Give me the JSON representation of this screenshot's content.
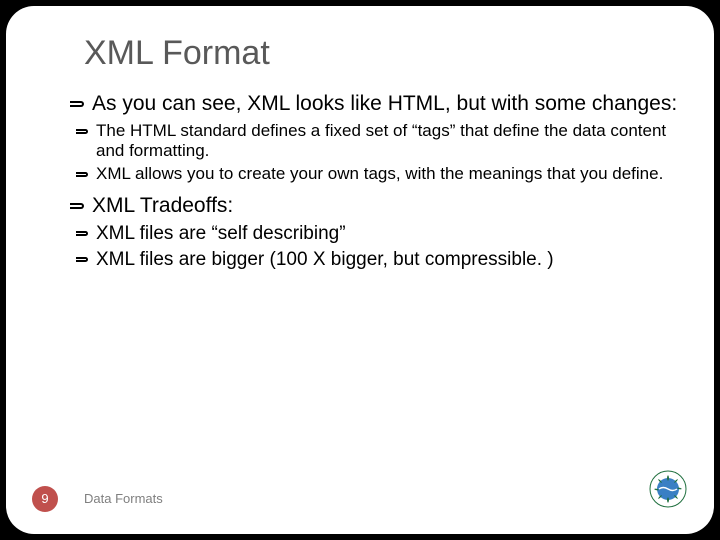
{
  "title": "XML Format",
  "bullets": {
    "p1": "As you can see, XML looks like HTML, but with some changes:",
    "p1a": "The HTML standard defines a fixed set of “tags” that define the data content and formatting.",
    "p1b": "XML allows you to create your own tags, with the meanings that you define.",
    "p2": "XML Tradeoffs:",
    "p2a": "XML files are “self describing”",
    "p2b": "XML files are bigger (100 X bigger, but compressible. )"
  },
  "footer": {
    "page": "9",
    "label": "Data Formats"
  }
}
